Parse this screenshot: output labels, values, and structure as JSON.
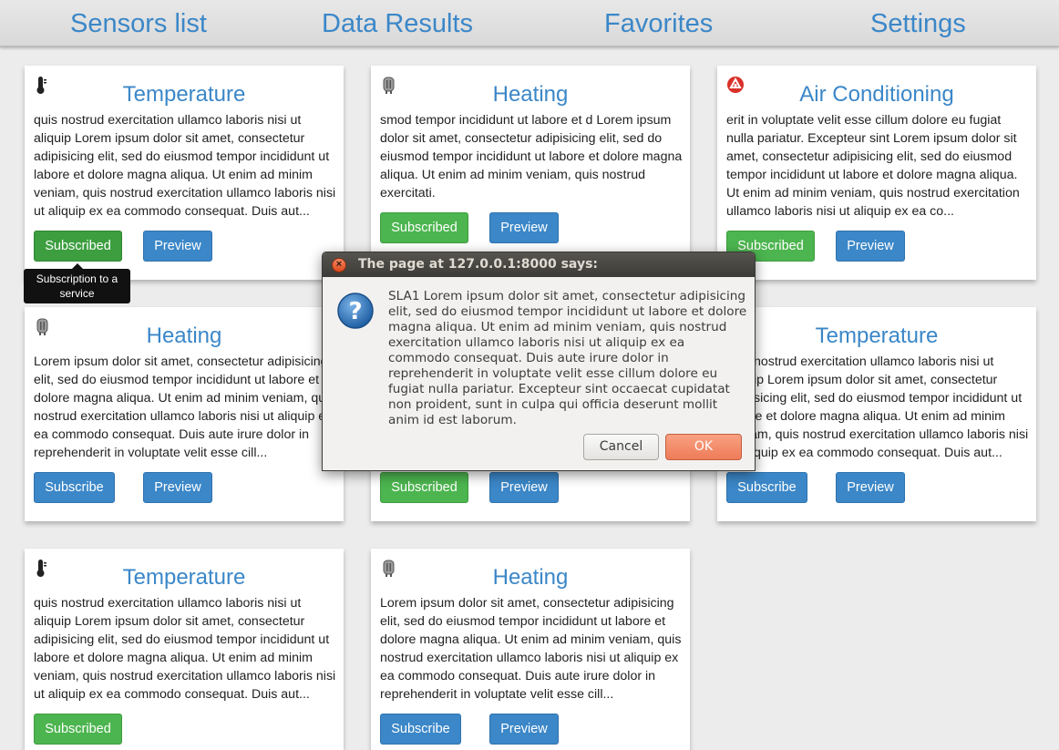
{
  "nav": {
    "sensors_list": "Sensors list",
    "data_results": "Data Results",
    "favorites": "Favorites",
    "settings": "Settings"
  },
  "cards": [
    {
      "title": "Temperature",
      "icon": "thermometer-icon",
      "description": "quis nostrud exercitation ullamco laboris nisi ut aliquip Lorem ipsum dolor sit amet, consectetur adipisicing elit, sed do eiusmod tempor incididunt ut labore et dolore magna aliqua. Ut enim ad minim veniam, quis nostrud exercitation ullamco laboris nisi ut aliquip ex ea commodo consequat. Duis aut...",
      "subscribe_label": "Subscribed",
      "preview_label": "Preview"
    },
    {
      "title": "Heating",
      "icon": "heater-icon",
      "description": "smod tempor incididunt ut labore et d Lorem ipsum dolor sit amet, consectetur adipisicing elit, sed do eiusmod tempor incididunt ut labore et dolore magna aliqua. Ut enim ad minim veniam, quis nostrud exercitati.",
      "subscribe_label": "Subscribed",
      "preview_label": "Preview"
    },
    {
      "title": "Air Conditioning",
      "icon": "air-conditioning-icon",
      "description": "erit in voluptate velit esse cillum dolore eu fugiat nulla pariatur. Excepteur sint Lorem ipsum dolor sit amet, consectetur adipisicing elit, sed do eiusmod tempor incididunt ut labore et dolore magna aliqua. Ut enim ad minim veniam, quis nostrud exercitation ullamco laboris nisi ut aliquip ex ea co...",
      "subscribe_label": "Subscribed",
      "preview_label": "Preview"
    },
    {
      "title": "Heating",
      "icon": "heater-icon",
      "description": "Lorem ipsum dolor sit amet, consectetur adipisicing elit, sed do eiusmod tempor incididunt ut labore et dolore magna aliqua. Ut enim ad minim veniam, quis nostrud exercitation ullamco laboris nisi ut aliquip ex ea commodo consequat. Duis aute irure dolor in reprehenderit in voluptate velit esse cill...",
      "subscribe_label": "Subscribe",
      "preview_label": "Preview"
    },
    {
      "title": "",
      "icon": "",
      "description": "",
      "subscribe_label": "Subscribed",
      "preview_label": "Preview"
    },
    {
      "title": "Temperature",
      "icon": "thermometer-icon",
      "description": "quis nostrud exercitation ullamco laboris nisi ut aliquip Lorem ipsum dolor sit amet, consectetur adipisicing elit, sed do eiusmod tempor incididunt ut labore et dolore magna aliqua. Ut enim ad minim veniam, quis nostrud exercitation ullamco laboris nisi ut aliquip ex ea commodo consequat. Duis aut...",
      "subscribe_label": "Subscribe",
      "preview_label": "Preview"
    },
    {
      "title": "Temperature",
      "icon": "thermometer-icon",
      "description": "quis nostrud exercitation ullamco laboris nisi ut aliquip Lorem ipsum dolor sit amet, consectetur adipisicing elit, sed do eiusmod tempor incididunt ut labore et dolore magna aliqua. Ut enim ad minim veniam, quis nostrud exercitation ullamco laboris nisi ut aliquip ex ea commodo consequat. Duis aut...",
      "subscribe_label": "Subscribed",
      "preview_label": ""
    },
    {
      "title": "Heating",
      "icon": "heater-icon",
      "description": "Lorem ipsum dolor sit amet, consectetur adipisicing elit, sed do eiusmod tempor incididunt ut labore et dolore magna aliqua. Ut enim ad minim veniam, quis nostrud exercitation ullamco laboris nisi ut aliquip ex ea commodo consequat. Duis aute irure dolor in reprehenderit in voluptate velit esse cill...",
      "subscribe_label": "Subscribe",
      "preview_label": "Preview"
    }
  ],
  "tooltip": "Subscription to a service",
  "dialog": {
    "title": "The page at 127.0.0.1:8000 says:",
    "message": "SLA1 Lorem ipsum dolor sit amet, consectetur adipisicing elit, sed do eiusmod tempor incididunt ut labore et dolore magna aliqua. Ut enim ad minim veniam, quis nostrud exercitation ullamco laboris nisi ut aliquip ex ea commodo consequat. Duis aute irure dolor in reprehenderit in voluptate velit esse cillum dolore eu fugiat nulla pariatur. Excepteur sint occaecat cupidatat non proident, sunt in culpa qui officia deserunt mollit anim id est laborum.",
    "cancel_label": "Cancel",
    "ok_label": "OK"
  },
  "colors": {
    "accent": "#3b87c8",
    "success": "#4cb54f",
    "background": "#ececec",
    "dialog_ok": "#ef7b58"
  }
}
